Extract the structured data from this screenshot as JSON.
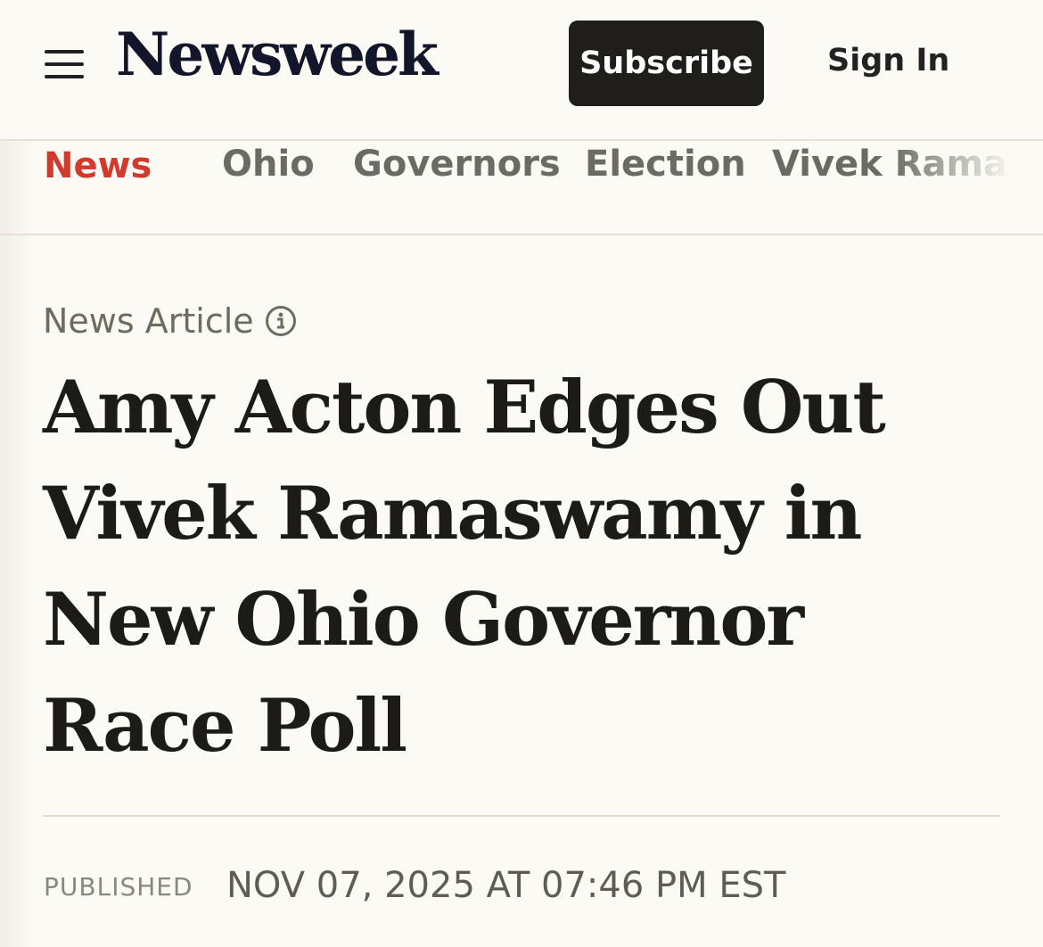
{
  "header": {
    "logo": "Newsweek",
    "subscribe_label": "Subscribe",
    "signin_label": "Sign In"
  },
  "nav": {
    "items": [
      {
        "label": "News",
        "active": true
      },
      {
        "label": "Ohio"
      },
      {
        "label": "Governors"
      },
      {
        "label": "Election"
      },
      {
        "label": "Vivek Ramas"
      }
    ]
  },
  "article": {
    "type": "News Article",
    "headline": "Amy Acton Edges Out Vivek Ramaswamy in New Ohio Governor Race Poll",
    "published_label": "PUBLISHED",
    "published_date": "NOV 07, 2025 AT 07:46 PM EST"
  },
  "colors": {
    "background": "#fbfaf4",
    "accent": "#d23a2b",
    "button": "#1f1e1b"
  },
  "icons": [
    "menu-icon",
    "info-icon"
  ]
}
